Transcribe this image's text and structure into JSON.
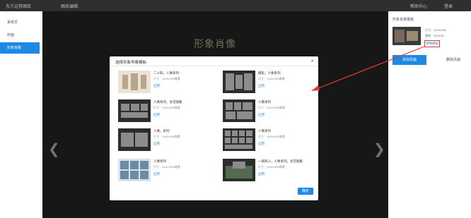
{
  "topbar": {
    "left": "东方证券图库",
    "middle": "图库编辑",
    "right1": "帮助中心",
    "right2": "登录"
  },
  "sidebar": {
    "items": [
      {
        "label": "系统页"
      },
      {
        "label": "封面"
      },
      {
        "label": "形象肖像"
      }
    ]
  },
  "canvas": {
    "title": "形象肖像"
  },
  "right_panel": {
    "title": "形象肖像模板",
    "line1": "尺寸：1440×900",
    "line2": "更新：2023.08",
    "change_label": "更换模板",
    "primary_label": "添加页面",
    "secondary_label": "删除页面"
  },
  "modal": {
    "title": "选择形象肖像模板",
    "confirm_label": "确定",
    "templates": [
      {
        "name": "二十四，人像系列",
        "size": "尺寸：1440×900像素",
        "use": "应用"
      },
      {
        "name": "摄影，人像系列",
        "size": "尺寸：1440×900像素",
        "use": "应用"
      },
      {
        "name": "人像系列，多宫图集",
        "size": "尺寸：1440×900像素",
        "use": "应用"
      },
      {
        "name": "人像系列",
        "size": "尺寸：1440×900像素",
        "use": "应用"
      },
      {
        "name": "人像，系列",
        "size": "尺寸：1440×900像素",
        "use": "应用"
      },
      {
        "name": "人像系列",
        "size": "尺寸：1440×900像素",
        "use": "应用"
      },
      {
        "name": "人像系列",
        "size": "尺寸：1440×900像素",
        "use": "应用"
      },
      {
        "name": "一排四人，人像系列，多宫图集",
        "size": "尺寸：1440×900像素",
        "use": "应用"
      }
    ]
  },
  "colors": {
    "accent": "#1e88e5",
    "annotation": "#e53935",
    "canvas_bg": "#2b2b2b"
  },
  "icons": {
    "close": "close-icon",
    "prev": "chevron-left-icon",
    "next": "chevron-right-icon"
  }
}
